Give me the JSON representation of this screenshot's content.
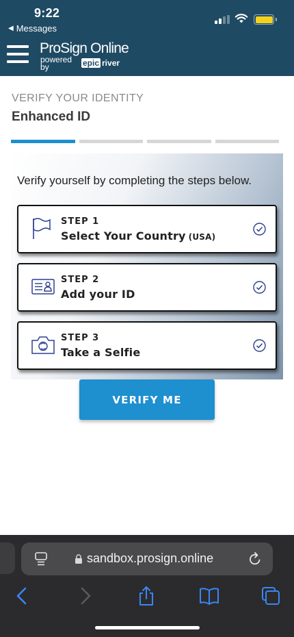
{
  "status_bar": {
    "time": "9:22",
    "back_label": "Messages",
    "battery_color": "#f3d21c"
  },
  "app_bar": {
    "menu_icon": "hamburger-menu-icon",
    "brand_name": "ProSign Online",
    "powered_by": "powered by",
    "partner_epic": "epic",
    "partner_river": "river",
    "background_color": "#1f4a63"
  },
  "page": {
    "eyebrow": "VERIFY YOUR IDENTITY",
    "title": "Enhanced ID",
    "progress": {
      "total_steps": 4,
      "current_step": 1,
      "active_color": "#1e8fcf"
    }
  },
  "panel": {
    "intro": "Verify yourself by completing the steps below.",
    "steps": [
      {
        "number": "STEP 1",
        "label": "Select Your Country",
        "note": "(USA)",
        "icon": "flag-icon",
        "status_icon": "check-circle-icon"
      },
      {
        "number": "STEP 2",
        "label": "Add your ID",
        "note": "",
        "icon": "id-card-icon",
        "status_icon": "check-circle-icon"
      },
      {
        "number": "STEP 3",
        "label": "Take a Selfie",
        "note": "",
        "icon": "camera-icon",
        "status_icon": "check-circle-icon"
      }
    ]
  },
  "actions": {
    "verify_label": "VERIFY ME",
    "accent_color": "#1e8fcf"
  },
  "browser": {
    "url": "sandbox.prosign.online",
    "reader_icon": "reader-mode-icon",
    "lock_icon": "lock-icon",
    "reload_icon": "reload-icon",
    "toolbar": [
      "back-icon",
      "forward-icon",
      "share-icon",
      "bookmarks-icon",
      "tabs-icon"
    ]
  }
}
